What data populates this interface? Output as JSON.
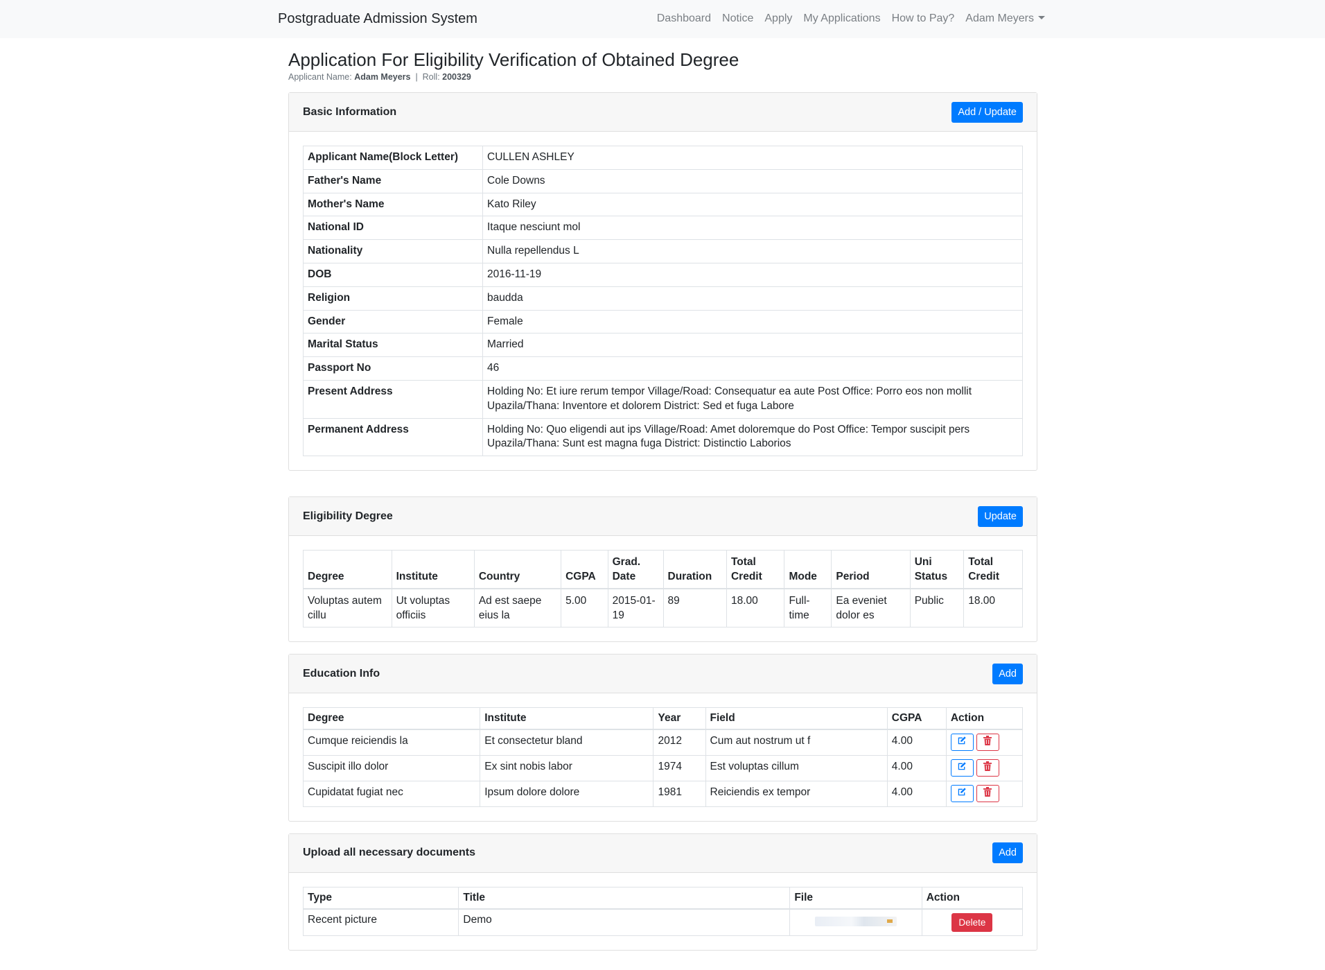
{
  "navbar": {
    "brand": "Postgraduate Admission System",
    "links": [
      "Dashboard",
      "Notice",
      "Apply",
      "My Applications",
      "How to Pay?"
    ],
    "user": "Adam Meyers"
  },
  "page": {
    "title": "Application For Eligibility Verification of Obtained Degree",
    "applicant_label": "Applicant Name:",
    "applicant_name": "Adam Meyers",
    "separator": "|",
    "roll_label": "Roll:",
    "roll": "200329"
  },
  "basic_info": {
    "title": "Basic Information",
    "button": "Add / Update",
    "rows": [
      {
        "label": "Applicant Name(Block Letter)",
        "value": "CULLEN ASHLEY"
      },
      {
        "label": "Father's Name",
        "value": "Cole Downs"
      },
      {
        "label": "Mother's Name",
        "value": "Kato Riley"
      },
      {
        "label": "National ID",
        "value": "Itaque nesciunt mol"
      },
      {
        "label": "Nationality",
        "value": "Nulla repellendus L"
      },
      {
        "label": "DOB",
        "value": "2016-11-19"
      },
      {
        "label": "Religion",
        "value": "baudda"
      },
      {
        "label": "Gender",
        "value": "Female"
      },
      {
        "label": "Marital Status",
        "value": "Married"
      },
      {
        "label": "Passport No",
        "value": "46"
      },
      {
        "label": "Present Address",
        "value": "Holding No: Et iure rerum tempor Village/Road: Consequatur ea aute Post Office: Porro eos non mollit Upazila/Thana: Inventore et dolorem District: Sed et fuga Labore"
      },
      {
        "label": "Permanent Address",
        "value": "Holding No: Quo eligendi aut ips Village/Road: Amet doloremque do Post Office: Tempor suscipit pers Upazila/Thana: Sunt est magna fuga District: Distinctio Laborios"
      }
    ]
  },
  "eligibility": {
    "title": "Eligibility Degree",
    "button": "Update",
    "headers": [
      "Degree",
      "Institute",
      "Country",
      "CGPA",
      "Grad. Date",
      "Duration",
      "Total Credit",
      "Mode",
      "Period",
      "Uni Status",
      "Total Credit"
    ],
    "row": [
      "Voluptas autem cillu",
      "Ut voluptas officiis",
      "Ad est saepe eius la",
      "5.00",
      "2015-01-19",
      "89",
      "18.00",
      "Full-time",
      "Ea eveniet dolor es",
      "Public",
      "18.00"
    ]
  },
  "education": {
    "title": "Education Info",
    "button": "Add",
    "headers": [
      "Degree",
      "Institute",
      "Year",
      "Field",
      "CGPA",
      "Action"
    ],
    "rows": [
      [
        "Cumque reiciendis la",
        "Et consectetur bland",
        "2012",
        "Cum aut nostrum ut f",
        "4.00"
      ],
      [
        "Suscipit illo dolor",
        "Ex sint nobis labor",
        "1974",
        "Est voluptas cillum",
        "4.00"
      ],
      [
        "Cupidatat fugiat nec",
        "Ipsum dolore dolore",
        "1981",
        "Reiciendis ex tempor",
        "4.00"
      ]
    ]
  },
  "documents": {
    "title": "Upload all necessary documents",
    "button": "Add",
    "headers": [
      "Type",
      "Title",
      "File",
      "Action"
    ],
    "row": {
      "type": "Recent picture",
      "title": "Demo",
      "delete": "Delete"
    }
  },
  "colors": {
    "primary": "#007bff",
    "danger": "#dc3545",
    "navbar": "#f8f9fa"
  }
}
